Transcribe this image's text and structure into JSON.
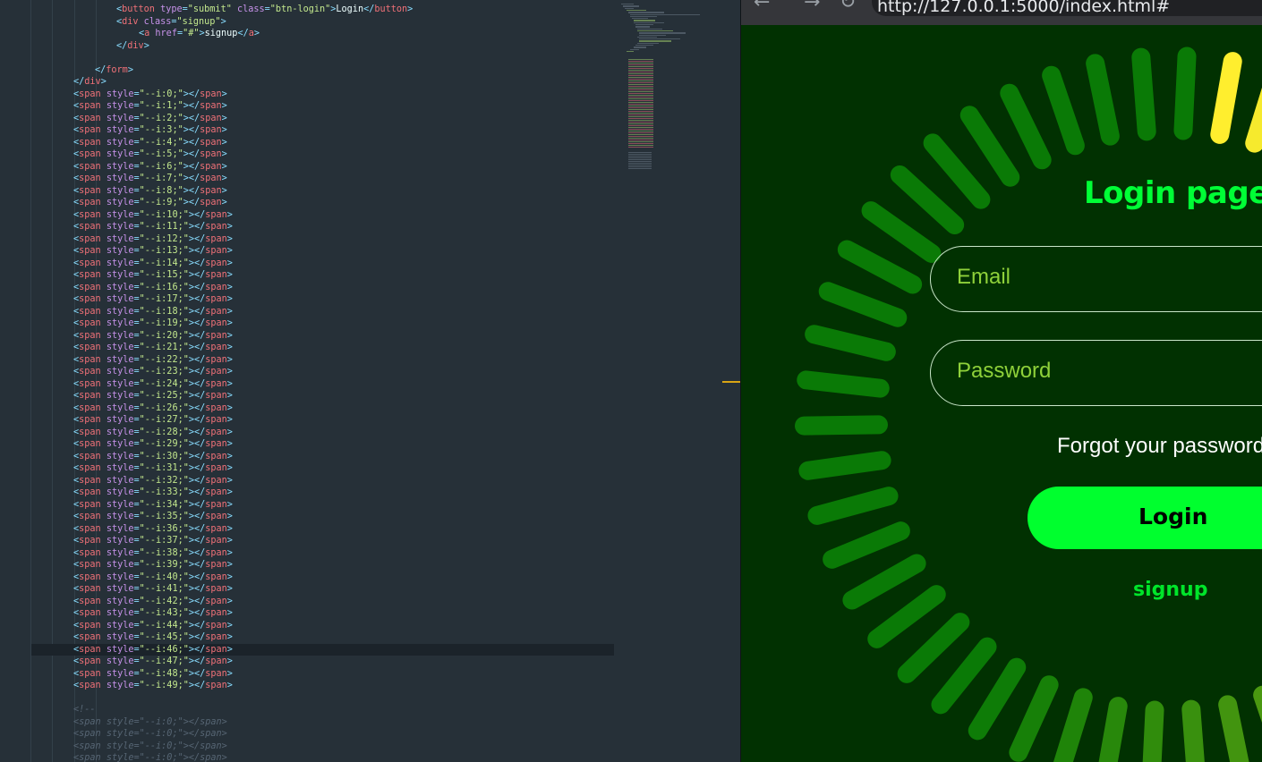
{
  "editor": {
    "code_lines": [
      [
        {
          "c": "tok-pun",
          "t": "<"
        },
        {
          "c": "tok-tag",
          "t": "button"
        },
        {
          "c": "tok-attr",
          "t": " type"
        },
        {
          "c": "tok-pun",
          "t": "="
        },
        {
          "c": "tok-str",
          "t": "\"submit\""
        },
        {
          "c": "tok-attr",
          "t": " class"
        },
        {
          "c": "tok-pun",
          "t": "="
        },
        {
          "c": "tok-str",
          "t": "\"btn-login\""
        },
        {
          "c": "tok-pun",
          "t": ">"
        },
        {
          "c": "tok-text",
          "t": "Login"
        },
        {
          "c": "tok-pun",
          "t": "</"
        },
        {
          "c": "tok-tag",
          "t": "button"
        },
        {
          "c": "tok-pun",
          "t": ">"
        }
      ],
      [
        {
          "c": "tok-pun",
          "t": "<"
        },
        {
          "c": "tok-tag",
          "t": "div"
        },
        {
          "c": "tok-attr",
          "t": " class"
        },
        {
          "c": "tok-pun",
          "t": "="
        },
        {
          "c": "tok-str",
          "t": "\"signup\""
        },
        {
          "c": "tok-pun",
          "t": ">"
        }
      ],
      [
        {
          "c": "tok-pun",
          "t": "<"
        },
        {
          "c": "tok-tag",
          "t": "a"
        },
        {
          "c": "tok-attr",
          "t": " href"
        },
        {
          "c": "tok-pun",
          "t": "="
        },
        {
          "c": "tok-str",
          "t": "\"#\""
        },
        {
          "c": "tok-pun",
          "t": ">"
        },
        {
          "c": "tok-text",
          "t": "signup"
        },
        {
          "c": "tok-pun",
          "t": "</"
        },
        {
          "c": "tok-tag",
          "t": "a"
        },
        {
          "c": "tok-pun",
          "t": ">"
        }
      ],
      [
        {
          "c": "tok-pun",
          "t": "</"
        },
        {
          "c": "tok-tag",
          "t": "div"
        },
        {
          "c": "tok-pun",
          "t": ">"
        }
      ],
      [],
      [
        {
          "c": "tok-pun",
          "t": "</"
        },
        {
          "c": "tok-tag",
          "t": "form"
        },
        {
          "c": "tok-pun",
          "t": ">"
        }
      ],
      [
        {
          "c": "tok-pun",
          "t": "</"
        },
        {
          "c": "tok-tag",
          "t": "div"
        },
        {
          "c": "tok-pun",
          "t": ">"
        }
      ]
    ],
    "span_count": 50,
    "comment_open": "<!--",
    "commented_span_count": 4
  },
  "browser": {
    "back_icon": "back-arrow-icon",
    "forward_icon": "forward-arrow-icon",
    "reload_icon": "reload-icon",
    "url": "http://127.0.0.1:5000/index.html#"
  },
  "login_page": {
    "title": "Login page",
    "email_placeholder": "Email",
    "password_placeholder": "Password",
    "forgot_text": "Forgot your password",
    "login_button": "Login",
    "signup_link": "signup",
    "colors": {
      "background": "#013101",
      "accent": "#00ff36",
      "bar_start": "#ffee2e",
      "bar_end": "#0a7a06"
    }
  }
}
